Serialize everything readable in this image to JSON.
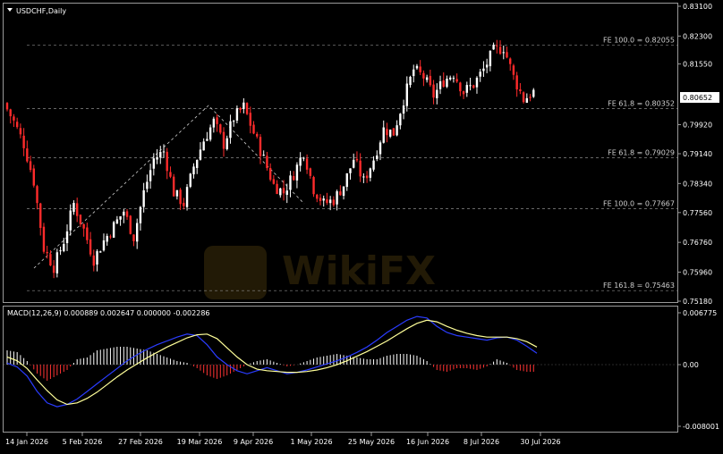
{
  "chart_title": "USDCHF,Daily",
  "price_axis": {
    "ticks": [
      "0.83100",
      "0.82300",
      "0.81550",
      "0.80652",
      "0.79920",
      "0.79140",
      "0.78340",
      "0.77560",
      "0.76760",
      "0.75960",
      "0.75180"
    ],
    "current_price": "0.80652"
  },
  "fib_levels": [
    {
      "label": "FE 100.0 = 0.82055",
      "value": 0.82055
    },
    {
      "label": "FE 61.8 = 0.80352",
      "value": 0.80352
    },
    {
      "label": "FE 61.8 = 0.79029",
      "value": 0.79029
    },
    {
      "label": "FE 100.0 = 0.77667",
      "value": 0.77667
    },
    {
      "label": "FE 161.8 = 0.75463",
      "value": 0.75463
    }
  ],
  "macd": {
    "label": "MACD(12,26,9) 0.000889 0.002647 0.000000 -0.002286",
    "ticks": [
      "0.006775",
      "0.00",
      "-0.008001"
    ]
  },
  "time_axis": [
    "14 Jan 2026",
    "5 Feb 2026",
    "27 Feb 2026",
    "19 Mar 2026",
    "9 Apr 2026",
    "1 May 2026",
    "25 May 2026",
    "16 Jun 2026",
    "8 Jul 2026",
    "30 Jul 2026"
  ],
  "watermark": "WikiFX",
  "colors": {
    "bull": "#ffffff",
    "bear": "#ff2b2b",
    "macd_line": "#2a3cff",
    "signal_line": "#ffff99",
    "grid": "#8a8a8a"
  },
  "chart_data": {
    "type": "candlestick",
    "ylim": [
      0.7518,
      0.831
    ],
    "price_path": [
      0.805,
      0.8,
      0.794,
      0.784,
      0.766,
      0.761,
      0.768,
      0.778,
      0.771,
      0.763,
      0.768,
      0.772,
      0.776,
      0.769,
      0.781,
      0.79,
      0.792,
      0.781,
      0.778,
      0.788,
      0.795,
      0.8,
      0.794,
      0.801,
      0.804,
      0.797,
      0.79,
      0.783,
      0.781,
      0.786,
      0.792,
      0.782,
      0.778,
      0.779,
      0.783,
      0.79,
      0.784,
      0.79,
      0.798,
      0.797,
      0.806,
      0.814,
      0.812,
      0.807,
      0.811,
      0.813,
      0.808,
      0.81,
      0.814,
      0.819,
      0.82,
      0.812,
      0.806,
      0.808
    ],
    "macd_hist": [
      0.8,
      0.7,
      0.2,
      -0.5,
      -0.9,
      -0.6,
      -0.3,
      0.3,
      0.4,
      0.8,
      0.9,
      1.0,
      1.0,
      0.9,
      0.8,
      0.6,
      0.4,
      0.2,
      0.1,
      -0.2,
      -0.6,
      -0.8,
      -0.6,
      -0.3,
      0.0,
      0.2,
      0.3,
      0.1,
      -0.1,
      0.0,
      0.2,
      0.4,
      0.5,
      0.6,
      0.5,
      0.4,
      0.3,
      0.3,
      0.5,
      0.6,
      0.6,
      0.5,
      0.2,
      -0.3,
      -0.4,
      -0.2,
      -0.2,
      -0.3,
      -0.1,
      0.3,
      0.1,
      -0.3,
      -0.4,
      -0.4
    ],
    "macd_main": [
      0.2,
      -0.3,
      -1.5,
      -3.5,
      -5.0,
      -5.5,
      -5.2,
      -4.5,
      -3.5,
      -2.5,
      -1.5,
      -0.5,
      0.5,
      1.3,
      2.0,
      2.6,
      3.1,
      3.6,
      4.0,
      3.8,
      2.6,
      1.0,
      0.0,
      -0.8,
      -1.2,
      -0.8,
      -0.4,
      -0.8,
      -1.2,
      -1.0,
      -0.7,
      -0.3,
      0.1,
      0.5,
      1.0,
      1.6,
      2.3,
      3.2,
      4.2,
      5.0,
      5.8,
      6.3,
      6.1,
      5.0,
      4.2,
      3.8,
      3.6,
      3.4,
      3.2,
      3.5,
      3.6,
      3.2,
      2.4,
      1.5
    ],
    "macd_signal": [
      1.0,
      0.5,
      -0.5,
      -2.0,
      -3.4,
      -4.6,
      -5.2,
      -5.0,
      -4.4,
      -3.6,
      -2.6,
      -1.6,
      -0.7,
      0.1,
      0.9,
      1.6,
      2.3,
      2.9,
      3.5,
      3.9,
      4.0,
      3.4,
      2.2,
      1.0,
      0.0,
      -0.6,
      -0.8,
      -0.9,
      -1.0,
      -1.0,
      -0.9,
      -0.7,
      -0.4,
      0.0,
      0.5,
      1.1,
      1.7,
      2.4,
      3.1,
      3.9,
      4.7,
      5.4,
      5.8,
      5.6,
      5.0,
      4.5,
      4.1,
      3.8,
      3.6,
      3.6,
      3.6,
      3.4,
      3.0,
      2.3
    ]
  }
}
